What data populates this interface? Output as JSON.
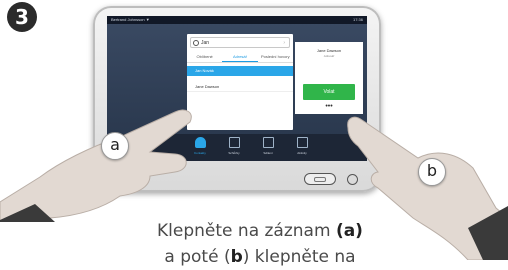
{
  "step": {
    "number": "3"
  },
  "status_bar": {
    "left": "Bertrand Johnsson ▼",
    "right": "17:36"
  },
  "contacts": {
    "search_value": "Jan",
    "tabs": [
      {
        "label": "Oblíbené",
        "active": false
      },
      {
        "label": "Adresář",
        "active": true
      },
      {
        "label": "Poslední hovory",
        "active": false
      }
    ],
    "rows": [
      {
        "label": "Jan Novák",
        "highlight": true
      },
      {
        "label": "Jane Dawson",
        "highlight": false
      }
    ]
  },
  "call_panel": {
    "name": "Jane Dawson",
    "sub": "Adresář",
    "call_label": "Volat",
    "more_label": "•••"
  },
  "bottom_nav": [
    {
      "label": "Kontakty",
      "active": true
    },
    {
      "label": "Schůzky",
      "active": false
    },
    {
      "label": "Sdílení",
      "active": false
    },
    {
      "label": "Aktivity",
      "active": false
    }
  ],
  "hands": {
    "left_label": "a",
    "right_label": "b"
  },
  "caption": {
    "line1_text": "Klepněte na záznam ",
    "line1_bold": "(a)",
    "line2_text_a": "a poté (",
    "line2_bold": "b",
    "line2_text_b": ") klepněte na"
  }
}
